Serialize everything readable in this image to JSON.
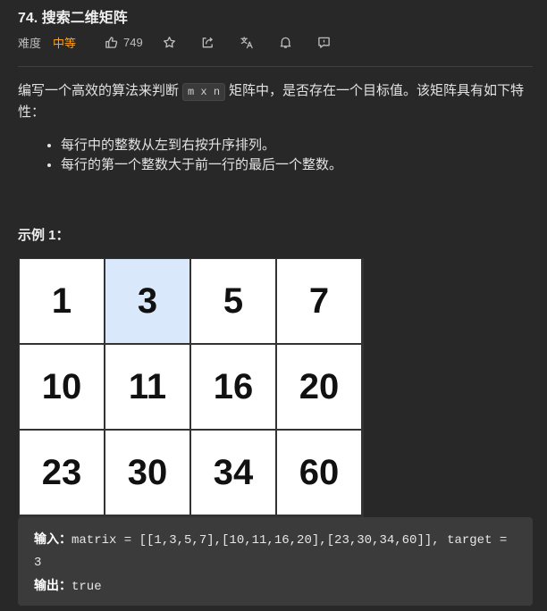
{
  "problem": {
    "title": "74. 搜索二维矩阵",
    "difficulty_label": "难度",
    "difficulty_value": "中等",
    "likes": "749",
    "description_before": "编写一个高效的算法来判断",
    "description_code": "m x n",
    "description_after": "矩阵中，是否存在一个目标值。该矩阵具有如下特性：",
    "bullets": [
      "每行中的整数从左到右按升序排列。",
      "每行的第一个整数大于前一行的最后一个整数。"
    ]
  },
  "example": {
    "heading": "示例 1：",
    "matrix_rows": [
      [
        "1",
        "3",
        "5",
        "7"
      ],
      [
        "10",
        "11",
        "16",
        "20"
      ],
      [
        "23",
        "30",
        "34",
        "60"
      ]
    ],
    "highlighted_value": "3",
    "input_label": "输入：",
    "input_value": "matrix = [[1,3,5,7],[10,11,16,20],[23,30,34,60]], target = 3",
    "output_label": "输出：",
    "output_value": "true"
  },
  "toolbar_icons": [
    "thumb-up-icon",
    "star-icon",
    "share-icon",
    "translate-icon",
    "bell-icon",
    "feedback-icon"
  ],
  "colors": {
    "background": "#282828",
    "difficulty_medium": "#ffa116",
    "highlight_cell": "#dae8fc"
  }
}
